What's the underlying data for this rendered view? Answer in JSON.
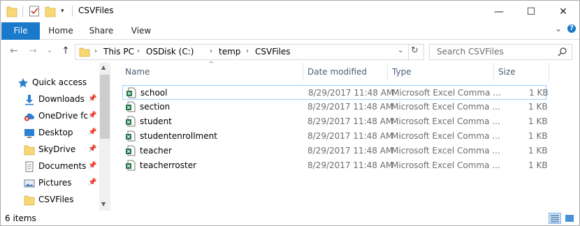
{
  "window": {
    "title": "CSVFiles",
    "controls": {
      "minimize": "—",
      "maximize": "☐",
      "close": "✕"
    }
  },
  "ribbon": {
    "tabs": [
      "File",
      "Home",
      "Share",
      "View"
    ],
    "collapse_glyph": "⌄",
    "help_glyph": "?"
  },
  "nav": {
    "back_glyph": "←",
    "forward_glyph": "→",
    "recent_glyph": "⌄",
    "up_glyph": "↑",
    "breadcrumb": [
      "This PC",
      "OSDisk (C:)",
      "temp",
      "CSVFiles"
    ],
    "refresh_glyph": "↻",
    "dropdown_glyph": "⌄",
    "search_placeholder": "Search CSVFiles"
  },
  "sidebar": {
    "items": [
      {
        "label": "Quick access",
        "icon": "star-icon",
        "pinned": false
      },
      {
        "label": "Downloads",
        "icon": "download-icon",
        "pinned": true
      },
      {
        "label": "OneDrive for",
        "icon": "onedrive-icon",
        "pinned": true
      },
      {
        "label": "Desktop",
        "icon": "desktop-icon",
        "pinned": true
      },
      {
        "label": "SkyDrive",
        "icon": "folder-icon",
        "pinned": true
      },
      {
        "label": "Documents",
        "icon": "documents-icon",
        "pinned": true
      },
      {
        "label": "Pictures",
        "icon": "pictures-icon",
        "pinned": true
      },
      {
        "label": "CSVFiles",
        "icon": "folder-icon",
        "pinned": false
      }
    ]
  },
  "filelist": {
    "columns": {
      "name": "Name",
      "date": "Date modified",
      "type": "Type",
      "size": "Size"
    },
    "sort_glyph": "^",
    "rows": [
      {
        "name": "school",
        "date": "8/29/2017 11:48 AM",
        "type": "Microsoft Excel Comma ...",
        "size": "1 KB",
        "selected": true
      },
      {
        "name": "section",
        "date": "8/29/2017 11:48 AM",
        "type": "Microsoft Excel Comma ...",
        "size": "1 KB",
        "selected": false
      },
      {
        "name": "student",
        "date": "8/29/2017 11:48 AM",
        "type": "Microsoft Excel Comma ...",
        "size": "1 KB",
        "selected": false
      },
      {
        "name": "studentenrollment",
        "date": "8/29/2017 11:48 AM",
        "type": "Microsoft Excel Comma ...",
        "size": "1 KB",
        "selected": false
      },
      {
        "name": "teacher",
        "date": "8/29/2017 11:48 AM",
        "type": "Microsoft Excel Comma ...",
        "size": "1 KB",
        "selected": false
      },
      {
        "name": "teacherroster",
        "date": "8/29/2017 11:48 AM",
        "type": "Microsoft Excel Comma ...",
        "size": "1 KB",
        "selected": false
      }
    ]
  },
  "status": {
    "item_count": "6 items"
  },
  "colors": {
    "accent": "#1979ca",
    "selection_border": "#99d1ff",
    "header_text": "#4c607a",
    "excel_green": "#1f7244"
  }
}
